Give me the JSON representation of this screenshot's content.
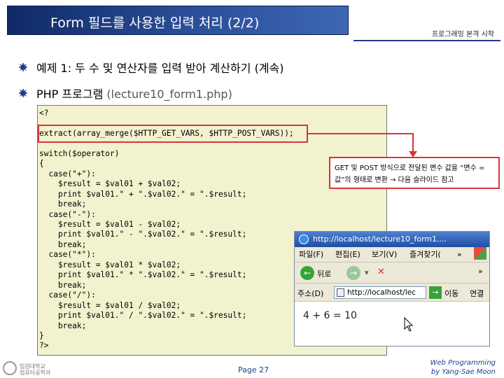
{
  "header": {
    "title": "Form 필드를 사용한 입력 처리 (2/2)",
    "subtitle_right": "프로그래밍 본격 시작"
  },
  "bullets": [
    {
      "text": "예제 1: 두 수 및 연산자를 입력 받아 계산하기 (계속)"
    },
    {
      "text": "PHP 프로그램",
      "sub": " (lecture10_form1.php)"
    }
  ],
  "code": {
    "text": "<?\n\nextract(array_merge($HTTP_GET_VARS, $HTTP_POST_VARS));\n\nswitch($operator)\n{\n  case(\"+\"):\n    $result = $val01 + $val02;\n    print $val01.\" + \".$val02.\" = \".$result;\n    break;\n  case(\"-\"):\n    $result = $val01 - $val02;\n    print $val01.\" - \".$val02.\" = \".$result;\n    break;\n  case(\"*\"):\n    $result = $val01 * $val02;\n    print $val01.\" * \".$val02.\" = \".$result;\n    break;\n  case(\"/\"):\n    $result = $val01 / $val02;\n    print $val01.\" / \".$val02.\" = \".$result;\n    break;\n}\n?>"
  },
  "note": {
    "text": "GET 및 POST 방식으로 전달된 변수 값을 “변수 = 값”의 형태로 변환 → 다음 슬라이드 참고"
  },
  "browser": {
    "title": "http://localhost/lecture10_form1....",
    "menu": [
      "파일(F)",
      "편집(E)",
      "보기(V)",
      "즐겨찾기(",
      "»"
    ],
    "toolbar": {
      "back_label": "뒤로",
      "more": "»"
    },
    "address_label": "주소(D)",
    "address_value": "http://localhost/lec",
    "go_label": "이동",
    "links_label": "연결",
    "result": "4 + 6 = 10"
  },
  "footer": {
    "logo_text": "입원대학교 컴퓨터공학과",
    "page": "Page 27",
    "right_line1": "Web Programming",
    "right_line2": "by Yang-Sae Moon"
  },
  "colors": {
    "title_bar": "#1d3f8a",
    "highlight": "#d9343c",
    "code_bg": "#f2f2cf"
  }
}
